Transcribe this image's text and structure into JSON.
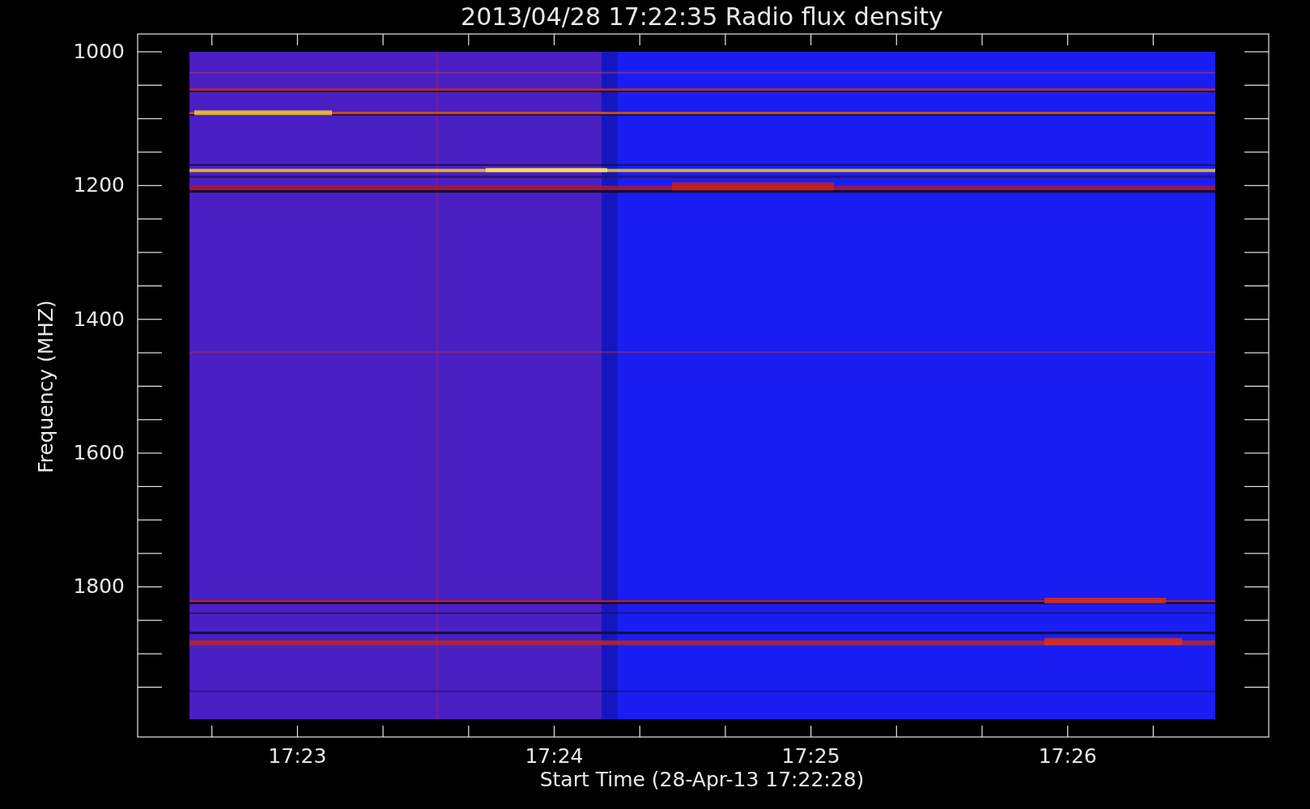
{
  "title": "2013/04/28 17:22:35 Radio flux density",
  "y_axis": {
    "label": "Frequency (MHZ)",
    "ticks": [
      "1000",
      "1200",
      "1400",
      "1600",
      "1800"
    ]
  },
  "x_axis": {
    "label": "Start Time (28-Apr-13 17:22:28)",
    "ticks": [
      "17:23",
      "17:24",
      "17:25",
      "17:26"
    ]
  }
}
